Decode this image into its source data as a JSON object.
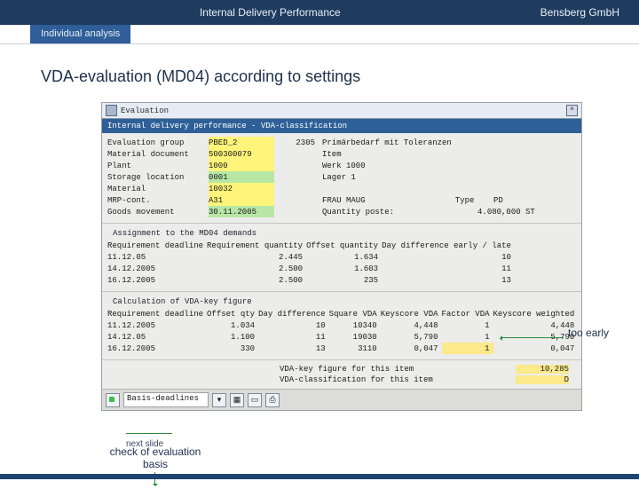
{
  "header": {
    "center": "Internal Delivery Performance",
    "right": "Bensberg GmbH"
  },
  "tab": {
    "label": "Individual analysis"
  },
  "slide": {
    "title": "VDA-evaluation (MD04) according to settings"
  },
  "sap": {
    "windowTitle": "Evaluation",
    "blueTitle": "Internal delivery performance - VDA-classification",
    "topFields": {
      "rows": [
        {
          "label": "Evaluation group",
          "v": "PBED_2",
          "mid": "2305",
          "right": "Primärbedarf mit Toleranzen",
          "hl": "Y"
        },
        {
          "label": "Material document",
          "v": "500300079",
          "mid": "",
          "right": "Item",
          "hl": "Y"
        },
        {
          "label": "Plant",
          "v": "1000",
          "mid": "",
          "right": "Werk 1000",
          "hl": "Y"
        },
        {
          "label": "Storage location",
          "v": "0001",
          "mid": "",
          "right": "Lager 1",
          "hl": "G"
        },
        {
          "label": "Material",
          "v": "10032",
          "mid": "",
          "right": "",
          "hl": "Y"
        },
        {
          "label": "MRP-cont.",
          "v": "A31",
          "mid": "",
          "right": "FRAU MAUG",
          "extra": "Type    PD",
          "hl": "Y"
        },
        {
          "label": "Goods movement",
          "v": "30.11.2005",
          "mid": "",
          "right": "Quantity poste:",
          "extra": "4.080,000 ST",
          "hl": "G"
        }
      ]
    },
    "sect2": {
      "heading": "Assignment to the MD04 demands",
      "cols": [
        "Requirement deadline",
        "Requirement quantity",
        "Offset quantity",
        "Day difference early / late"
      ],
      "rows": [
        {
          "d": "11.12.05",
          "rq": "2.445",
          "off": "1.634",
          "dd": "10"
        },
        {
          "d": "14.12.2005",
          "rq": "2.500",
          "off": "1.603",
          "dd": "11"
        },
        {
          "d": "16.12.2005",
          "rq": "2.500",
          "off": "235",
          "dd": "13"
        }
      ]
    },
    "sect3": {
      "heading": "Calculation of VDA-key figure",
      "cols": [
        "Requirement deadline",
        "Offset qty",
        "Day difference",
        "Square VDA",
        "Keyscore VDA",
        "Factor VDA",
        "Keyscore weighted"
      ],
      "rows": [
        {
          "d": "11.12.2005",
          "off": "1.034",
          "dd": "10",
          "sq": "10340",
          "ks": "4,448",
          "fa": "1",
          "kw": "4,448"
        },
        {
          "d": "14.12.05",
          "off": "1.100",
          "dd": "11",
          "sq": "19030",
          "ks": "5,790",
          "fa": "1",
          "kw": "5,790"
        },
        {
          "d": "16.12.2005",
          "off": "330",
          "dd": "13",
          "sq": "3110",
          "ks": "0,047",
          "fa": "1",
          "kw": "0,047"
        }
      ]
    },
    "kv": {
      "rows": [
        {
          "l": "VDA-key figure for this item",
          "v": "10,285"
        },
        {
          "l": "VDA-classification for this item",
          "v": "D"
        }
      ]
    },
    "status": {
      "field": "Basis-deadlines"
    }
  },
  "annotations": {
    "tooEarly": "too early",
    "nextSlide": "next slide",
    "checkBasis": "check of evaluation basis"
  },
  "icons": {
    "window": "window-icon",
    "close": "close-icon",
    "checkGreen": "check-green-icon",
    "dd": "dropdown-icon",
    "grid": "grid-icon",
    "page": "page-icon",
    "print": "print-icon"
  }
}
